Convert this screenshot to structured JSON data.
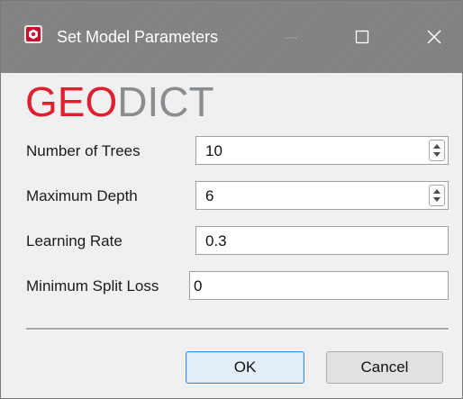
{
  "window": {
    "title": "Set Model Parameters",
    "app_icon": "geodict-icon",
    "controls": [
      "minimize-icon",
      "maximize-icon",
      "close-icon"
    ]
  },
  "logo": {
    "part1": "GEO",
    "part2": "DICT",
    "colors": {
      "geo": "#e0202e",
      "dict": "#8a8d90"
    }
  },
  "form": {
    "num_trees": {
      "label": "Number of Trees",
      "value": "10"
    },
    "max_depth": {
      "label": "Maximum Depth",
      "value": "6"
    },
    "learning_rate": {
      "label": "Learning Rate",
      "value": "0.3"
    },
    "min_split_loss": {
      "label": "Minimum Split Loss",
      "value": "0"
    }
  },
  "buttons": {
    "ok": "OK",
    "cancel": "Cancel"
  },
  "colors": {
    "titlebar": "#808080",
    "accent": "#3c8fd8",
    "background": "#f0f0f0"
  }
}
